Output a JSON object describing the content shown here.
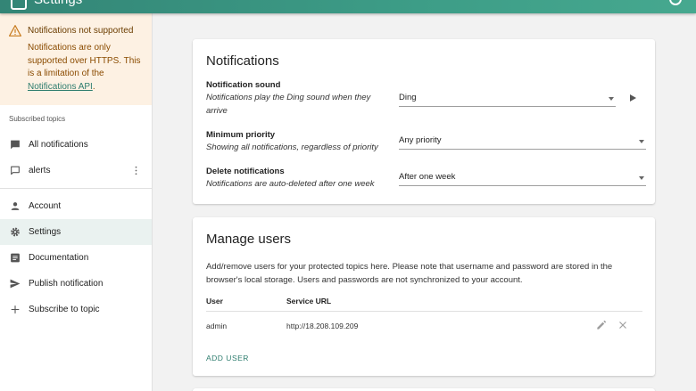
{
  "app": {
    "title": "Settings"
  },
  "sidebar": {
    "warning": {
      "title": "Notifications not supported",
      "text": "Notifications are only supported over HTTPS. This is a limitation of the ",
      "link": "Notifications API",
      "text_end": "."
    },
    "section_label": "Subscribed topics",
    "topics": [
      {
        "label": "All notifications",
        "icon": "chat-icon"
      },
      {
        "label": "alerts",
        "icon": "chat-outline-icon"
      }
    ],
    "items": [
      {
        "label": "Account",
        "icon": "person-icon"
      },
      {
        "label": "Settings",
        "icon": "gear-icon",
        "active": true
      },
      {
        "label": "Documentation",
        "icon": "article-icon"
      },
      {
        "label": "Publish notification",
        "icon": "send-icon"
      },
      {
        "label": "Subscribe to topic",
        "icon": "plus-icon"
      }
    ]
  },
  "notifications": {
    "title": "Notifications",
    "sound": {
      "label": "Notification sound",
      "desc": "Notifications play the Ding sound when they arrive",
      "value": "Ding"
    },
    "priority": {
      "label": "Minimum priority",
      "desc": "Showing all notifications, regardless of priority",
      "value": "Any priority"
    },
    "delete": {
      "label": "Delete notifications",
      "desc": "Notifications are auto-deleted after one week",
      "value": "After one week"
    }
  },
  "manage_users": {
    "title": "Manage users",
    "text": "Add/remove users for your protected topics here. Please note that username and password are stored in the browser's local storage. Users and passwords are not synchronized to your account.",
    "columns": [
      "User",
      "Service URL"
    ],
    "rows": [
      {
        "user": "admin",
        "url": "http://18.208.109.209"
      }
    ],
    "add_label": "ADD USER"
  },
  "colors": {
    "accent": "#3a9784",
    "warning_bg": "#fdf1e3",
    "link": "#2e7d6e"
  }
}
